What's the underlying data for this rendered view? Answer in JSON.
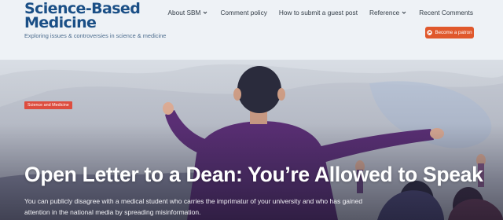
{
  "header": {
    "logo_title": "Science-Based\nMedicine",
    "tagline": "Exploring issues & controversies in science & medicine",
    "nav": [
      {
        "label": "About SBM",
        "has_dropdown": true
      },
      {
        "label": "Comment policy",
        "has_dropdown": false
      },
      {
        "label": "How to submit a guest post",
        "has_dropdown": false
      },
      {
        "label": "Reference",
        "has_dropdown": true
      },
      {
        "label": "Recent Comments",
        "has_dropdown": false
      }
    ],
    "patron_button": {
      "label": "Become a patron",
      "icon": "patreon-icon",
      "color": "#e0582c"
    }
  },
  "hero": {
    "category": "Science and Medicine",
    "category_color": "#dd4d3f",
    "title": "Open Letter to a Dean: You’re Allowed to Speak",
    "excerpt": "You can publicly disagree with a medical student who carries the imprimatur of your university and who has gained attention in the national media by spreading misinformation."
  },
  "colors": {
    "header_bg": "#eef2f6",
    "logo": "#1a4f86",
    "purple_jacket": "#5f2f7a"
  }
}
